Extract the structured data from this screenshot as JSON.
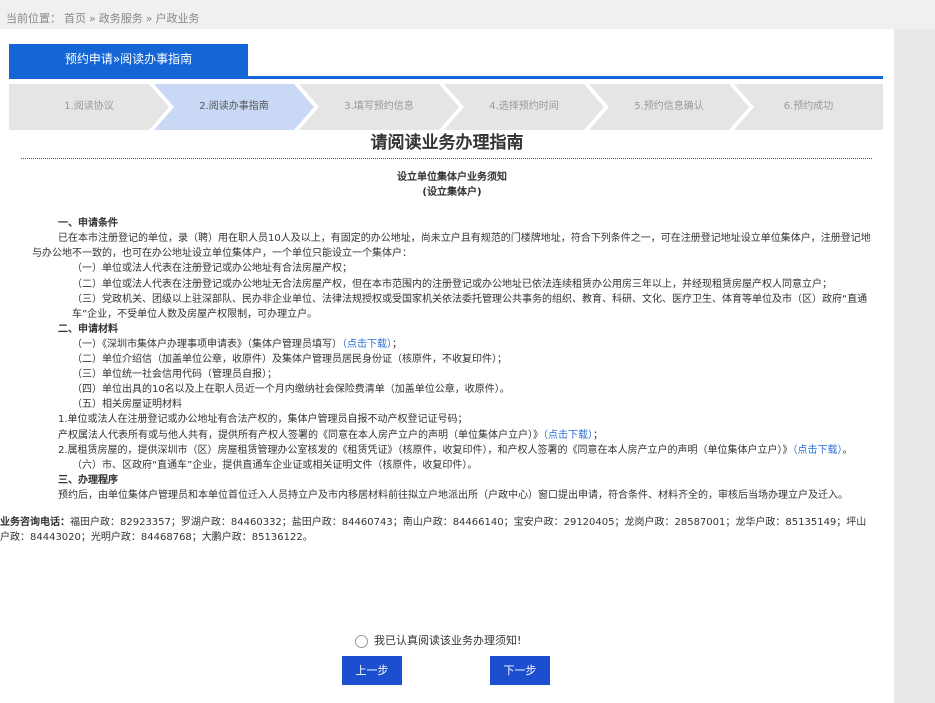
{
  "breadcrumb": {
    "prefix": "当前位置：",
    "items": [
      "首页",
      "»",
      "政务服务",
      "»",
      "户政业务"
    ]
  },
  "tab": {
    "label": "预约申请»阅读办事指南"
  },
  "steps": [
    {
      "label": "1.阅读协议",
      "active": false
    },
    {
      "label": "2.阅读办事指南",
      "active": true
    },
    {
      "label": "3.填写预约信息",
      "active": false
    },
    {
      "label": "4.选择预约时间",
      "active": false
    },
    {
      "label": "5.预约信息确认",
      "active": false
    },
    {
      "label": "6.预约成功",
      "active": false
    }
  ],
  "heading": "请阅读业务办理指南",
  "doc": {
    "title1": "设立单位集体户业务须知",
    "title2": "(设立集体户)",
    "sec1": "一、申请条件",
    "p1": "已在本市注册登记的单位，录（聘）用在职人员10人及以上，有固定的办公地址，尚未立户且有规范的门楼牌地址，符合下列条件之一，可在注册登记地址设立单位集体户，注册登记地与办公地不一致的，也可在办公地址设立单位集体户，一个单位只能设立一个集体户：",
    "c1": "（一）单位或法人代表在注册登记或办公地址有合法房屋产权；",
    "c2": "（二）单位或法人代表在注册登记或办公地址无合法房屋产权，但在本市范围内的注册登记或办公地址已依法连续租赁办公用房三年以上，并经现租赁房屋产权人同意立户；",
    "c3": "（三）党政机关、团级以上驻深部队、民办非企业单位、法律法规授权或受国家机关依法委托管理公共事务的组织、教育、科研、文化、医疗卫生、体育等单位及市（区）政府“直通车”企业，不受单位人数及房屋产权限制，可办理立户。",
    "sec2": "二、申请材料",
    "m1a": "（一）《深圳市集体户办理事项申请表》（集体户管理员填写）",
    "m1link": "（点击下载）",
    "m1b": "；",
    "m2": "（二）单位介绍信（加盖单位公章，收原件）及集体户管理员居民身份证（核原件，不收复印件）；",
    "m3": "（三）单位统一社会信用代码（管理员自报）；",
    "m4": "（四）单位出具的10名以及上在职人员近一个月内缴纳社会保险费清单（加盖单位公章，收原件）。",
    "m5": "（五）相关房屋证明材料",
    "m5a": "1.单位或法人在注册登记或办公地址有合法产权的，集体户管理员自报不动产权登记证号码；",
    "m5b1": "产权属法人代表所有或与他人共有，提供所有产权人签署的《同意在本人房产立户的声明（单位集体户立户）》",
    "m5blink": "（点击下载）",
    "m5b2": "；",
    "m5c": "2.属租赁房屋的，提供深圳市（区）房屋租赁管理办公室核发的《租赁凭证》（核原件，收复印件），和产权人签署的《同意在本人房产立户的声明（单位集体户立户）》",
    "m5clink": "（点击下载）",
    "m5c2": "。",
    "m6": "（六）市、区政府“直通车”企业，提供直通车企业证或相关证明文件（核原件，收复印件）。",
    "sec3": "三、办理程序",
    "p3": "预约后，由单位集体户管理员和本单位首位迁入人员持立户及市内移居材料前往拟立户地派出所（户政中心）窗口提出申请，符合条件、材料齐全的，审核后当场办理立户及迁入。",
    "contact_label": "业务咨询电话：",
    "contact": "福田户政：82923357；罗湖户政：84460332；盐田户政：84460743；南山户政：84466140；宝安户政：29120405；龙岗户政：28587001；龙华户政：85135149；坪山户政：84443020；光明户政：84468768；大鹏户政：85136122。"
  },
  "agree_label": "我已认真阅读该业务办理须知!",
  "buttons": {
    "prev": "上一步",
    "next": "下一步"
  },
  "colors": {
    "accent": "#1466d6",
    "step_active": "#c9d9f5",
    "step_inactive": "#e5e5e5",
    "button": "#1c4fd0",
    "link": "#2a6fd6"
  }
}
